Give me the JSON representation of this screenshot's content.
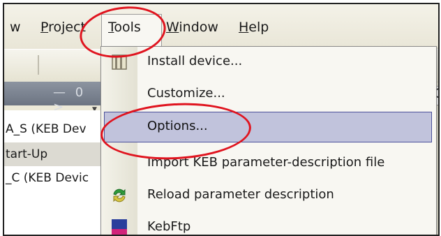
{
  "menubar": {
    "items": [
      {
        "label": "w"
      },
      {
        "label": "Project"
      },
      {
        "label": "Tools"
      },
      {
        "label": "Window"
      },
      {
        "label": "Help"
      }
    ]
  },
  "toolbar": {
    "partial_text": "— 0 >",
    "right_field_label": "C"
  },
  "tree": {
    "rows": [
      {
        "label": "A_S (KEB Dev"
      },
      {
        "label": "tart-Up"
      },
      {
        "label": "_C (KEB Devic"
      }
    ]
  },
  "tools_menu": {
    "items": [
      {
        "label": "Install device...",
        "icon": "install-device-icon"
      },
      {
        "label": "Customize...",
        "icon": ""
      },
      {
        "label": "Options...",
        "icon": "",
        "highlighted": true
      },
      {
        "label": "Import KEB parameter-description file",
        "icon": ""
      },
      {
        "label": "Reload parameter description",
        "icon": "reload-icon"
      },
      {
        "label": "KebFtp",
        "icon": "ftp-keb-icon"
      }
    ]
  },
  "colors": {
    "highlight": "#c1c3dc",
    "highlight_border": "#4a4f9a",
    "annotation": "#e0141f"
  }
}
